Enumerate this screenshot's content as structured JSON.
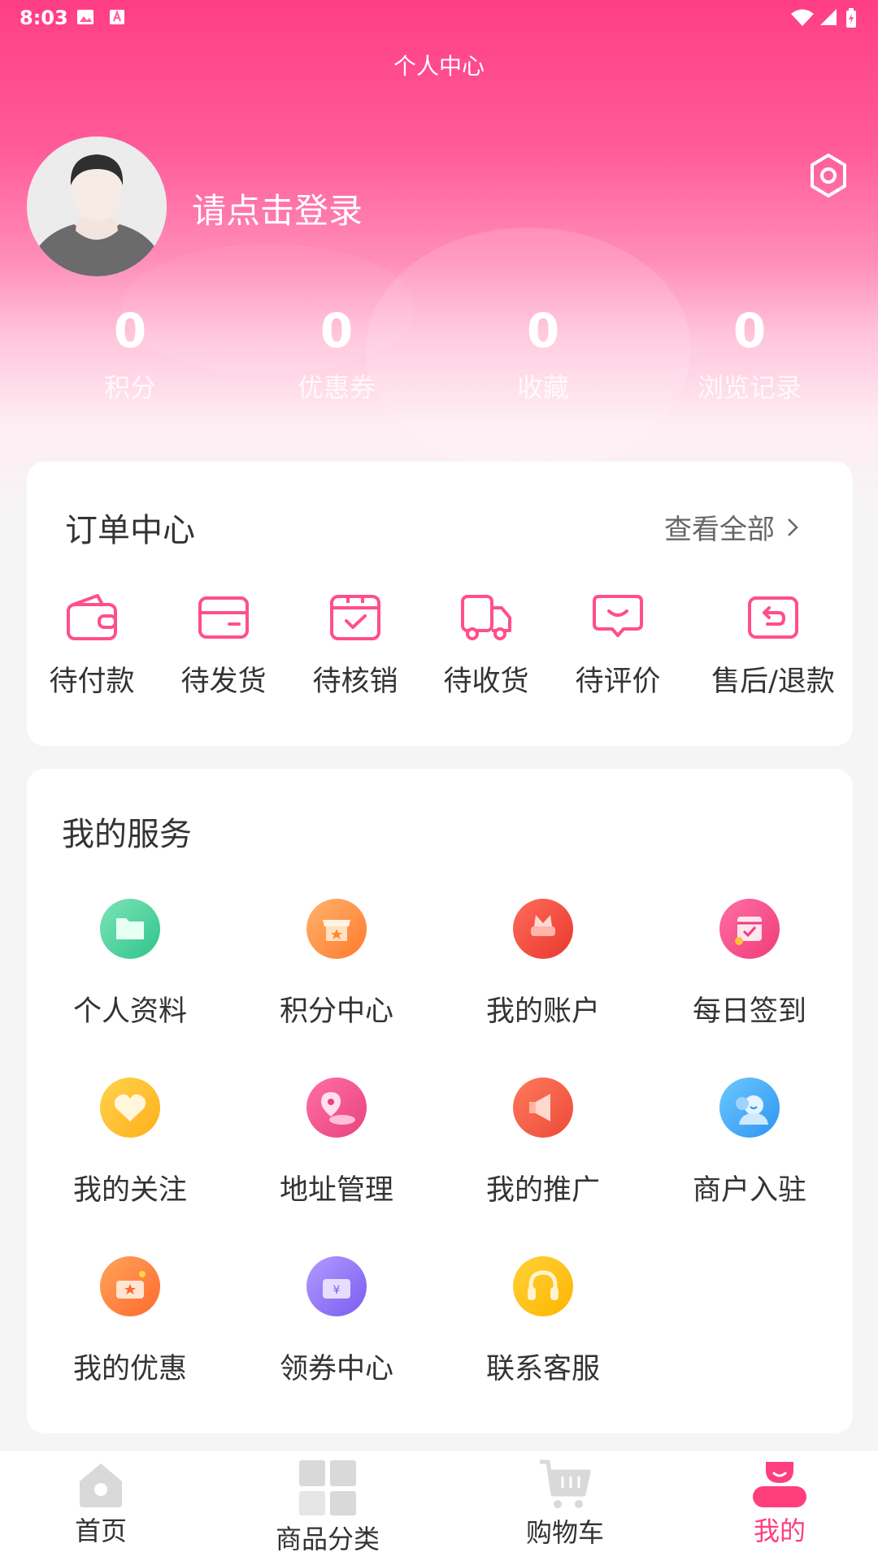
{
  "status": {
    "time": "8:03"
  },
  "header": {
    "title": "个人中心",
    "login_prompt": "请点击登录"
  },
  "stats": [
    {
      "value": "0",
      "label": "积分"
    },
    {
      "value": "0",
      "label": "优惠券"
    },
    {
      "value": "0",
      "label": "收藏"
    },
    {
      "value": "0",
      "label": "浏览记录"
    }
  ],
  "orders": {
    "title": "订单中心",
    "view_all": "查看全部",
    "items": [
      {
        "label": "待付款",
        "icon": "wallet-icon"
      },
      {
        "label": "待发货",
        "icon": "card-icon"
      },
      {
        "label": "待核销",
        "icon": "verify-box-icon"
      },
      {
        "label": "待收货",
        "icon": "truck-icon"
      },
      {
        "label": "待评价",
        "icon": "comment-icon"
      },
      {
        "label": "售后/退款",
        "icon": "refund-icon"
      }
    ]
  },
  "services": {
    "title": "我的服务",
    "items": [
      {
        "label": "个人资料",
        "icon": "folder-icon"
      },
      {
        "label": "积分中心",
        "icon": "points-shop-icon"
      },
      {
        "label": "我的账户",
        "icon": "account-icon"
      },
      {
        "label": "每日签到",
        "icon": "calendar-icon"
      },
      {
        "label": "我的关注",
        "icon": "heart-icon"
      },
      {
        "label": "地址管理",
        "icon": "location-icon"
      },
      {
        "label": "我的推广",
        "icon": "megaphone-icon"
      },
      {
        "label": "商户入驻",
        "icon": "merchant-icon"
      },
      {
        "label": "我的优惠",
        "icon": "discount-ticket-icon"
      },
      {
        "label": "领券中心",
        "icon": "coupon-center-icon"
      },
      {
        "label": "联系客服",
        "icon": "headset-icon"
      }
    ]
  },
  "nav": [
    {
      "label": "首页",
      "icon": "home-icon"
    },
    {
      "label": "商品分类",
      "icon": "category-icon"
    },
    {
      "label": "购物车",
      "icon": "cart-icon"
    },
    {
      "label": "我的",
      "icon": "profile-icon"
    }
  ],
  "colors": {
    "primary": "#ff3e86",
    "accent": "#ff3e7e",
    "order_icon": "#ff4f8b"
  }
}
